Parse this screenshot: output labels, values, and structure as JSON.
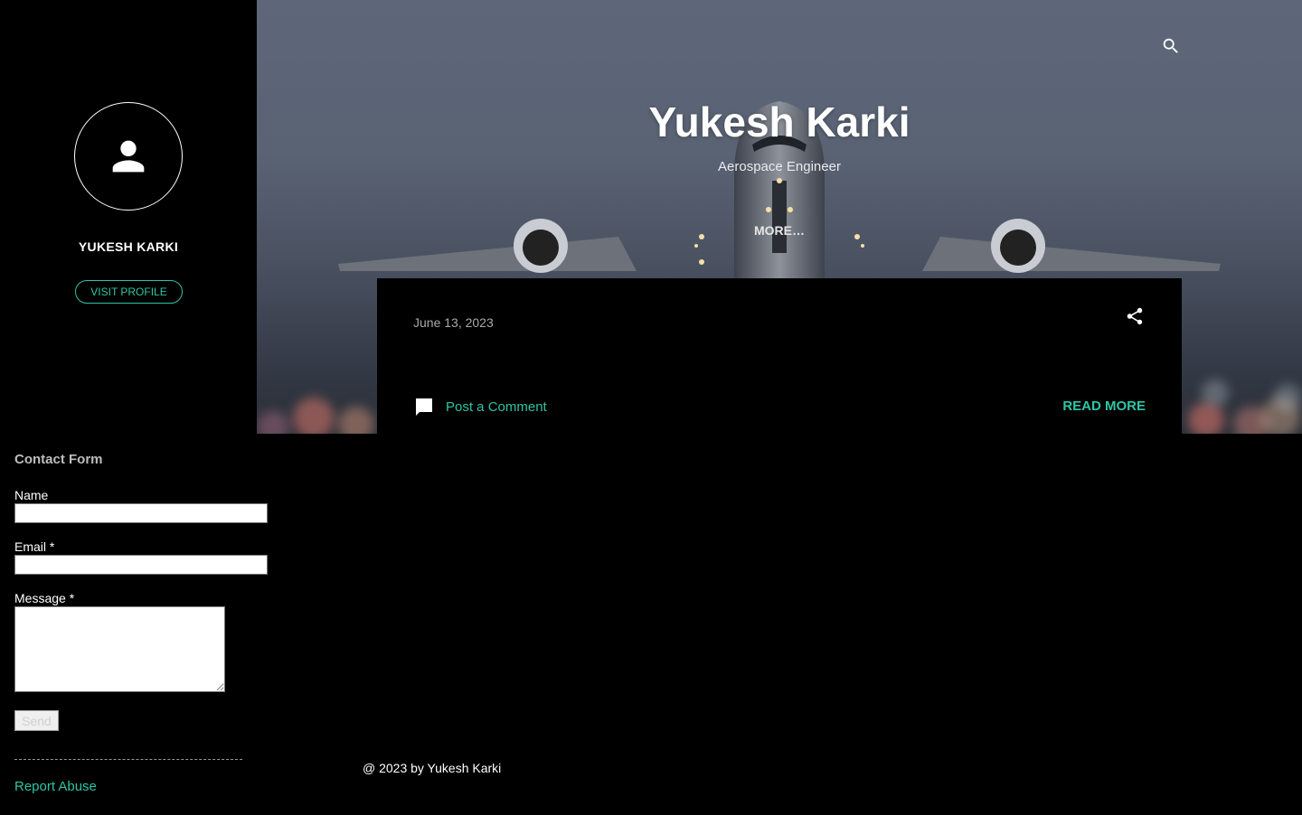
{
  "sidebar": {
    "profile_name": "YUKESH KARKI",
    "visit_profile": "VISIT PROFILE"
  },
  "hero": {
    "title": "Yukesh Karki",
    "subtitle": "Aerospace Engineer",
    "more": "MORE…",
    "search_icon": "search-icon"
  },
  "post": {
    "date": "June 13, 2023",
    "comment": "Post a Comment",
    "read_more": "READ MORE",
    "share_icon": "share-icon",
    "comment_icon": "comment-icon"
  },
  "contact": {
    "title": "Contact Form",
    "name_label": "Name",
    "email_label": "Email *",
    "message_label": "Message *",
    "send": "Send"
  },
  "report_abuse": "Report Abuse",
  "footer": "@ 2023 by Yukesh Karki",
  "colors": {
    "accent": "#2ec4a5",
    "background": "#000000",
    "muted_text": "#a9a9a9"
  }
}
